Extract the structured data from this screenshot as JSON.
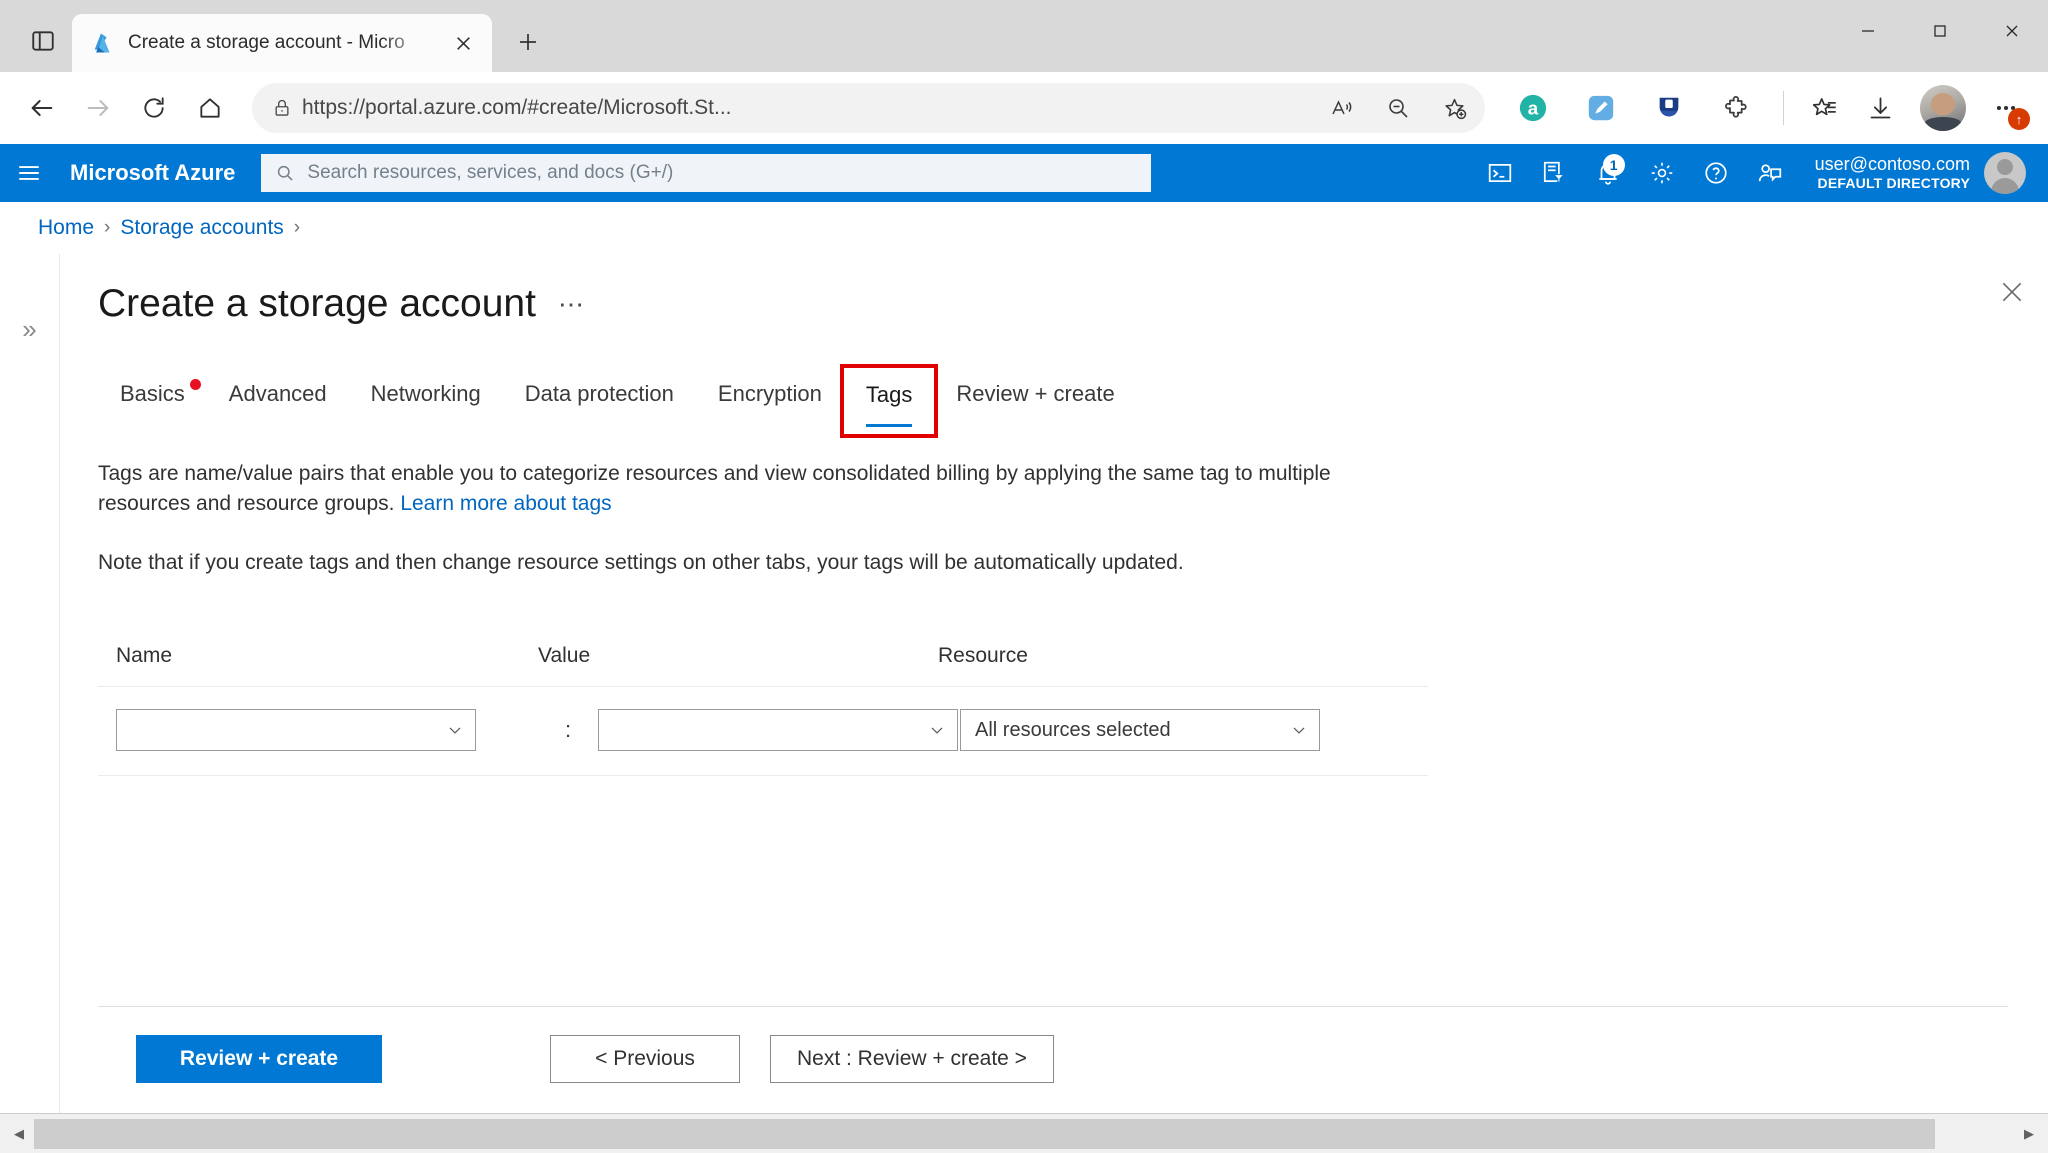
{
  "browser": {
    "tab": {
      "title": "Create a storage account - Micro",
      "favicon_icon": "azure-logo-icon",
      "close_icon": "close-icon"
    },
    "tab_actions_icon": "tab-actions-icon",
    "new_tab_icon": "new-tab-plus-icon",
    "window": {
      "minimize_icon": "minimize-icon",
      "maximize_icon": "maximize-icon",
      "close_icon": "window-close-icon"
    },
    "nav": {
      "back_icon": "back-arrow-icon",
      "forward_icon": "forward-arrow-icon",
      "refresh_icon": "refresh-icon",
      "home_icon": "home-icon"
    },
    "omnibox": {
      "lock_icon": "lock-icon",
      "url_display": "https://portal.azure.com/#create/Microsoft.St...",
      "url_domain": "portal.azure.com",
      "url_prefix": "https://",
      "url_suffix": "/#create/Microsoft.St...",
      "read_aloud_icon": "read-aloud-icon",
      "zoom_icon": "zoom-out-icon",
      "add_favorite_icon": "add-favorite-star-icon"
    },
    "extensions": [
      {
        "name": "extension-icon-a",
        "glyph": "a",
        "color": "#20b2aa"
      },
      {
        "name": "extension-icon-pen",
        "glyph": "",
        "color": "#58a6e0"
      },
      {
        "name": "extension-icon-u",
        "glyph": "",
        "color": "#1f3c88"
      },
      {
        "name": "extensions-puzzle-icon",
        "glyph": "",
        "color": "#3b3b3b"
      }
    ],
    "toolbar": {
      "collections_icon": "collections-icon",
      "downloads_icon": "downloads-icon",
      "profile_icon": "profile-avatar-icon",
      "settings_more_icon": "settings-and-more-icon",
      "settings_more_badge": "↑"
    }
  },
  "azure_header": {
    "menu_icon": "hamburger-menu-icon",
    "brand": "Microsoft Azure",
    "search": {
      "icon": "search-icon",
      "placeholder": "Search resources, services, and docs (G+/)",
      "value": ""
    },
    "actions": [
      {
        "name": "cloud-shell-icon",
        "label": "Cloud Shell"
      },
      {
        "name": "directories-subscriptions-icon",
        "label": "Directories + subscriptions"
      },
      {
        "name": "notifications-bell-icon",
        "label": "Notifications",
        "badge": "1"
      },
      {
        "name": "settings-gear-icon",
        "label": "Settings"
      },
      {
        "name": "help-question-icon",
        "label": "Help"
      },
      {
        "name": "feedback-icon",
        "label": "Feedback"
      }
    ],
    "account": {
      "email": "user@contoso.com",
      "directory": "DEFAULT DIRECTORY",
      "avatar_icon": "user-avatar-icon"
    }
  },
  "breadcrumb": {
    "items": [
      "Home",
      "Storage accounts"
    ],
    "separator": "›",
    "trailing_separator": "›"
  },
  "blade": {
    "title": "Create a storage account",
    "ellipsis": "⋯",
    "close_icon": "blade-close-icon",
    "rail_expand_icon": "expand-chevron-icon",
    "rail_expand_glyph": "»",
    "tabs": [
      {
        "label": "Basics",
        "active": false,
        "required_dot": true,
        "annotated": false
      },
      {
        "label": "Advanced",
        "active": false,
        "required_dot": false,
        "annotated": false
      },
      {
        "label": "Networking",
        "active": false,
        "required_dot": false,
        "annotated": false
      },
      {
        "label": "Data protection",
        "active": false,
        "required_dot": false,
        "annotated": false
      },
      {
        "label": "Encryption",
        "active": false,
        "required_dot": false,
        "annotated": false
      },
      {
        "label": "Tags",
        "active": true,
        "required_dot": false,
        "annotated": true
      },
      {
        "label": "Review + create",
        "active": false,
        "required_dot": false,
        "annotated": false
      }
    ],
    "description": {
      "part1": "Tags are name/value pairs that enable you to categorize resources and view consolidated billing by applying the same tag to multiple resources and resource groups. ",
      "link": "Learn more about tags"
    },
    "note": "Note that if you create tags and then change resource settings on other tabs, your tags will be automatically updated.",
    "table": {
      "headers": [
        "Name",
        "Value",
        "Resource"
      ],
      "rows": [
        {
          "name_value": "",
          "name_placeholder": "",
          "colon": ":",
          "value_value": "",
          "value_placeholder": "",
          "resource_value": "All resources selected"
        }
      ],
      "chevron_icon": "chevron-down-icon"
    },
    "footer": {
      "review_create": "Review + create",
      "previous": "< Previous",
      "next": "Next : Review + create >"
    }
  },
  "scrollbar": {
    "left_arrow": "◀",
    "right_arrow": "▶"
  },
  "colors": {
    "azure_blue": "#0078d4",
    "link_blue": "#0066c0",
    "annotation_red": "#e00000",
    "required_red": "#e81123"
  }
}
